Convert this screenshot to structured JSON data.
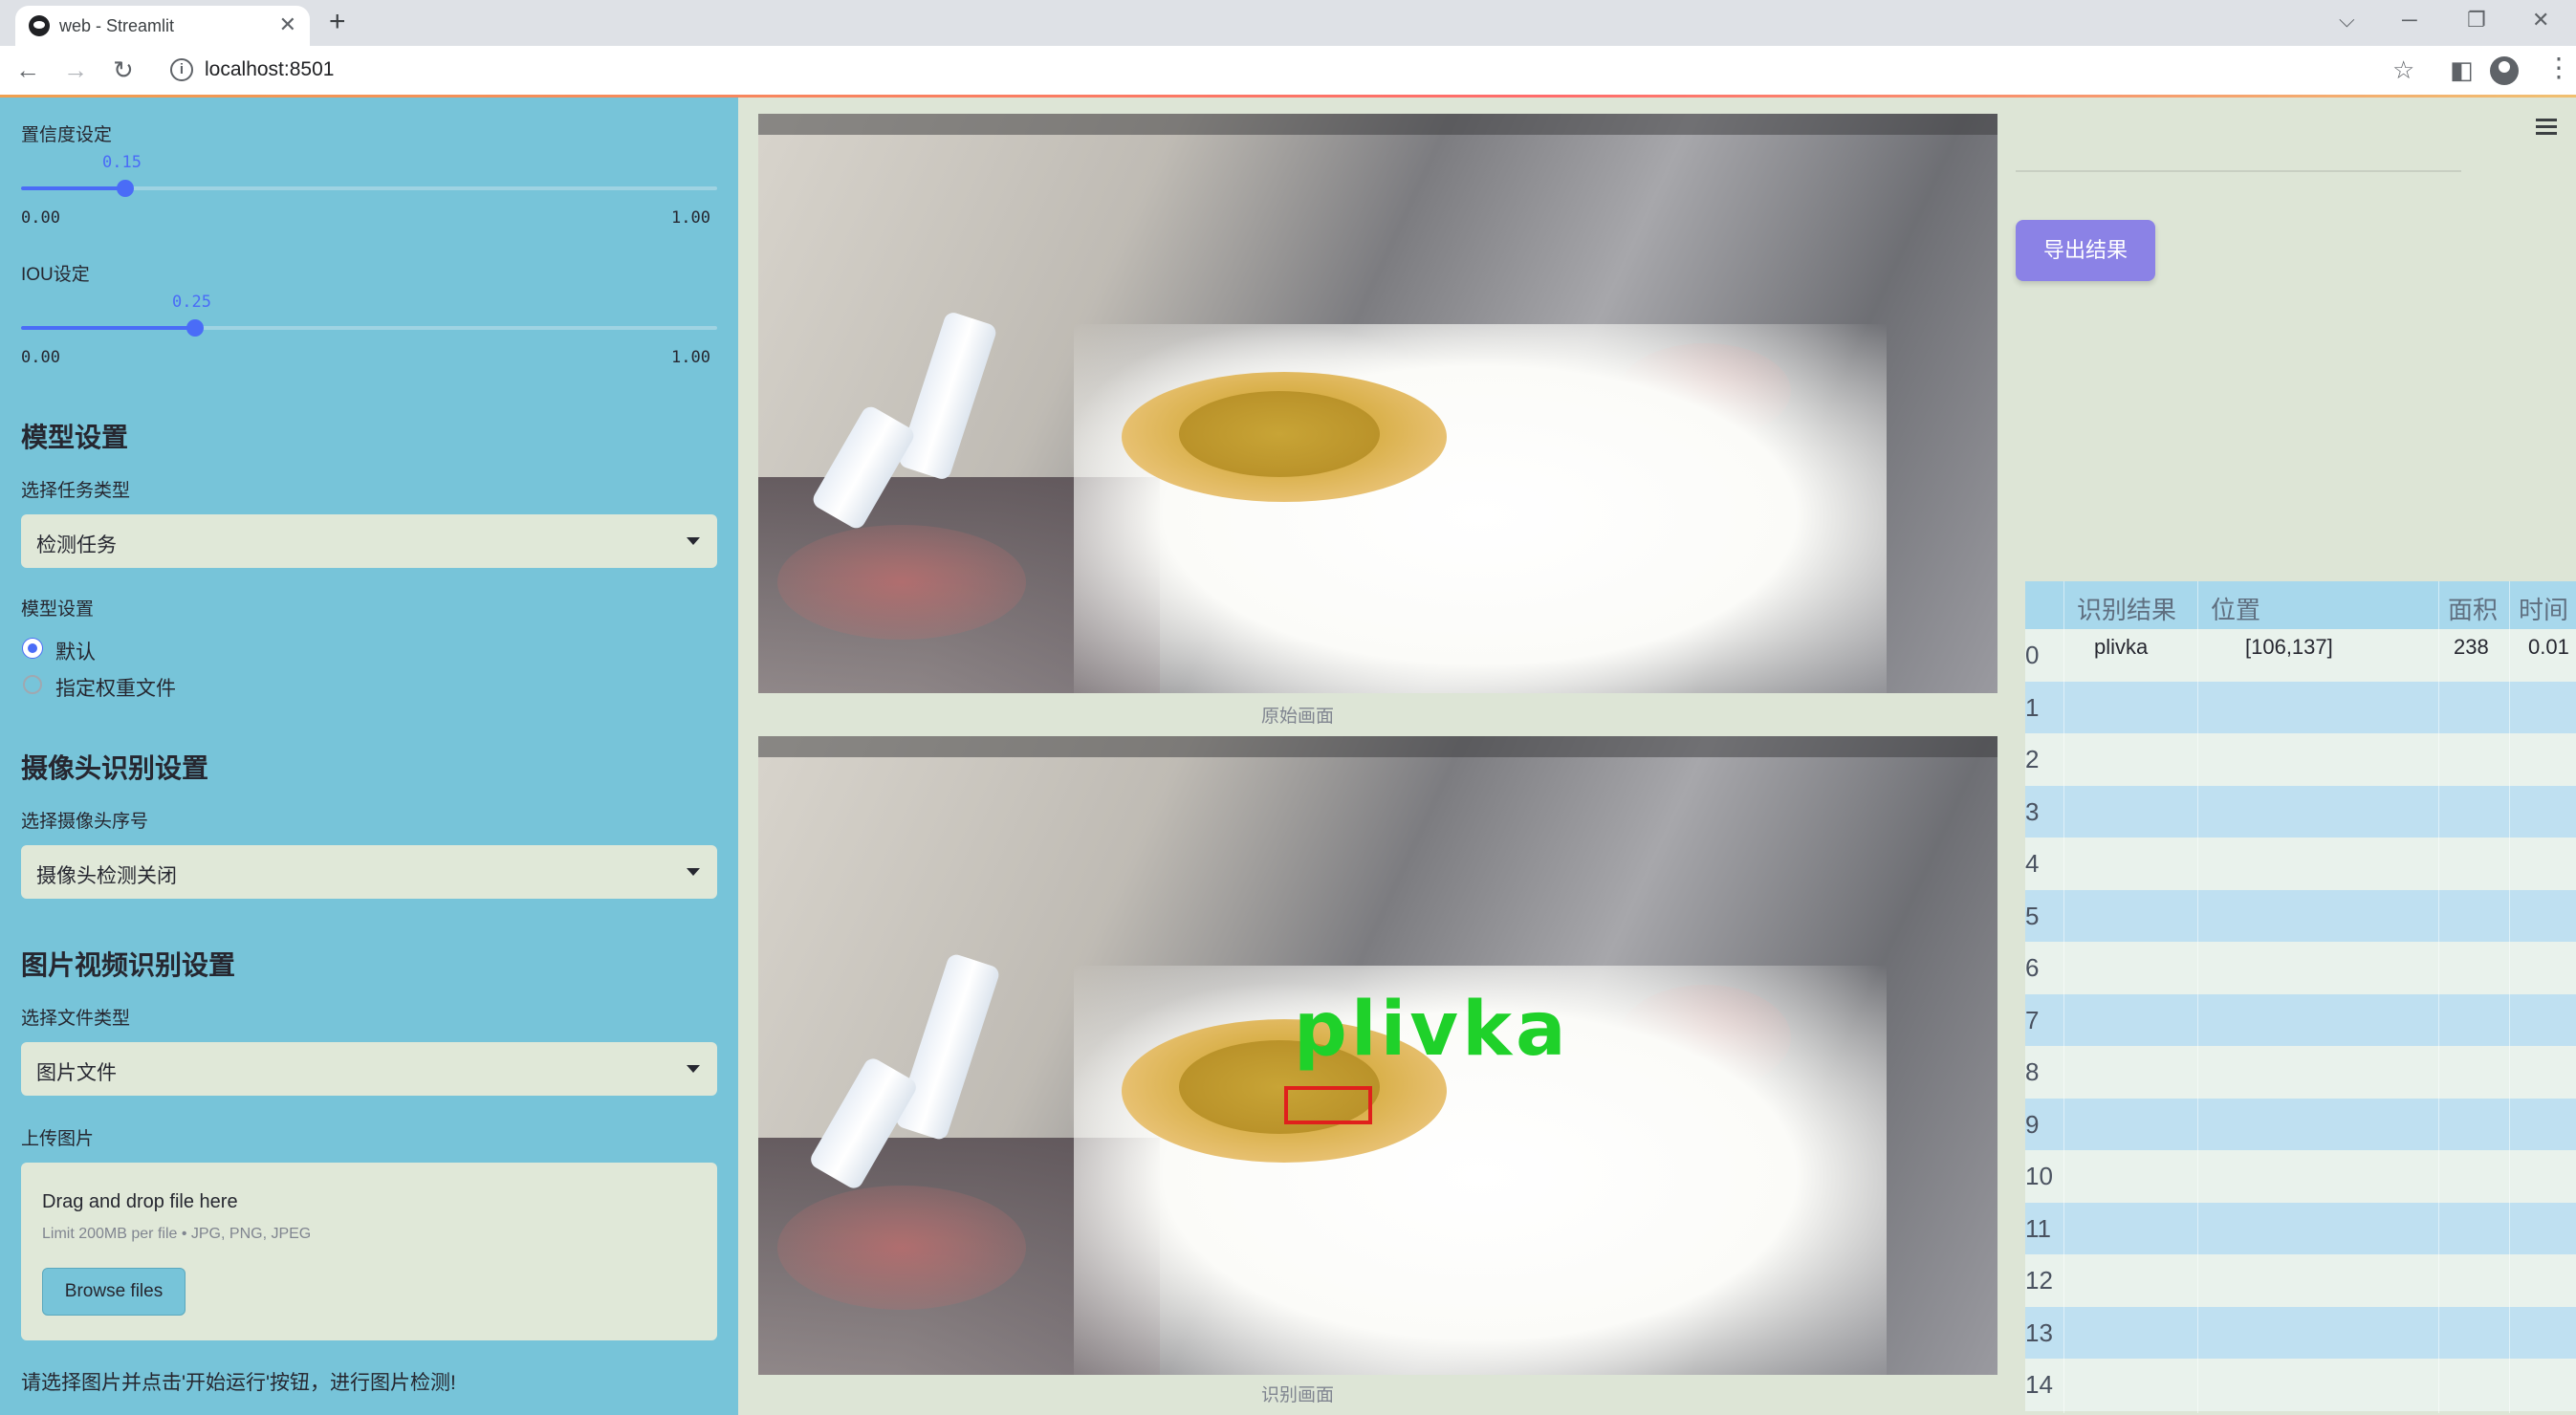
{
  "browser": {
    "tab_title": "web - Streamlit",
    "tab_close": "✕",
    "new_tab": "+",
    "url": "localhost:8501",
    "back": "←",
    "forward": "→",
    "reload": "↻",
    "info": "i",
    "star": "☆",
    "split": "◧",
    "menu": "⋮",
    "win_chevron": "⌵",
    "win_min": "─",
    "win_restore": "❐",
    "win_close": "✕"
  },
  "sidebar": {
    "confidence": {
      "label": "置信度设定",
      "value": "0.15",
      "min": "0.00",
      "max": "1.00",
      "fraction": 0.15
    },
    "iou": {
      "label": "IOU设定",
      "value": "0.25",
      "min": "0.00",
      "max": "1.00",
      "fraction": 0.25
    },
    "model_heading": "模型设置",
    "task_label": "选择任务类型",
    "task_value": "检测任务",
    "model_sub_label": "模型设置",
    "radio_default": "默认",
    "radio_custom": "指定权重文件",
    "camera_heading": "摄像头识别设置",
    "camera_label": "选择摄像头序号",
    "camera_value": "摄像头检测关闭",
    "media_heading": "图片视频识别设置",
    "file_type_label": "选择文件类型",
    "file_type_value": "图片文件",
    "upload_label": "上传图片",
    "upload_title": "Drag and drop file here",
    "upload_limit": "Limit 200MB per file • JPG, PNG, JPEG",
    "browse_label": "Browse files",
    "hint": "请选择图片并点击'开始运行'按钮，进行图片检测!"
  },
  "main": {
    "original_caption": "原始画面",
    "result_caption": "识别画面",
    "detection_label": "plivka",
    "export_label": "导出结果"
  },
  "results": {
    "headers": [
      "识别结果",
      "位置",
      "面积",
      "时间"
    ],
    "rows": [
      {
        "idx": "0",
        "cls": "plivka",
        "pos": "[106,137]",
        "area": "238",
        "time": "0.01"
      },
      {
        "idx": "1",
        "cls": "",
        "pos": "",
        "area": "",
        "time": ""
      },
      {
        "idx": "2",
        "cls": "",
        "pos": "",
        "area": "",
        "time": ""
      },
      {
        "idx": "3",
        "cls": "",
        "pos": "",
        "area": "",
        "time": ""
      },
      {
        "idx": "4",
        "cls": "",
        "pos": "",
        "area": "",
        "time": ""
      },
      {
        "idx": "5",
        "cls": "",
        "pos": "",
        "area": "",
        "time": ""
      },
      {
        "idx": "6",
        "cls": "",
        "pos": "",
        "area": "",
        "time": ""
      },
      {
        "idx": "7",
        "cls": "",
        "pos": "",
        "area": "",
        "time": ""
      },
      {
        "idx": "8",
        "cls": "",
        "pos": "",
        "area": "",
        "time": ""
      },
      {
        "idx": "9",
        "cls": "",
        "pos": "",
        "area": "",
        "time": ""
      },
      {
        "idx": "10",
        "cls": "",
        "pos": "",
        "area": "",
        "time": ""
      },
      {
        "idx": "11",
        "cls": "",
        "pos": "",
        "area": "",
        "time": ""
      },
      {
        "idx": "12",
        "cls": "",
        "pos": "",
        "area": "",
        "time": ""
      },
      {
        "idx": "13",
        "cls": "",
        "pos": "",
        "area": "",
        "time": ""
      },
      {
        "idx": "14",
        "cls": "",
        "pos": "",
        "area": "",
        "time": ""
      }
    ]
  },
  "colors": {
    "sidebar_bg": "#77c4d9",
    "accent": "#4a6cf7",
    "export_button": "#8b82e6",
    "detection_box": "#e0201c",
    "detection_text": "#1fd12a"
  }
}
